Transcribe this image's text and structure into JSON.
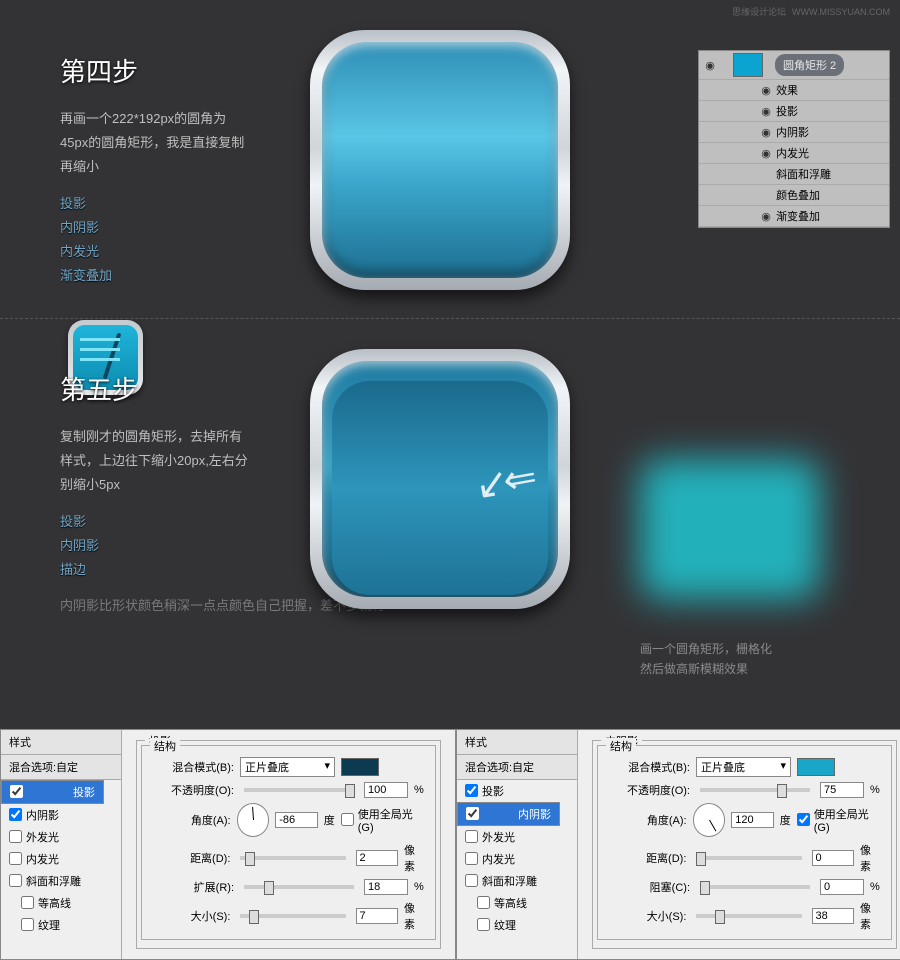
{
  "watermark": {
    "text": "思缘设计论坛",
    "url": "WWW.MISSYUAN.COM"
  },
  "step4": {
    "title": "第四步",
    "desc": "再画一个222*192px的圆角为45px的圆角矩形，我是直接复制再缩小",
    "effects": [
      "投影",
      "内阴影",
      "内发光",
      "渐变叠加"
    ]
  },
  "layers": {
    "name": "圆角矩形 2",
    "fxHeader": "效果",
    "items": [
      {
        "eye": true,
        "label": "投影"
      },
      {
        "eye": true,
        "label": "内阴影"
      },
      {
        "eye": true,
        "label": "内发光"
      },
      {
        "eye": false,
        "label": "斜面和浮雕"
      },
      {
        "eye": false,
        "label": "颜色叠加"
      },
      {
        "eye": true,
        "label": "渐变叠加"
      }
    ]
  },
  "step5": {
    "title": "第五步",
    "desc": "复制刚才的圆角矩形，去掉所有样式，上边往下缩小20px,左右分别缩小5px",
    "effects": [
      "投影",
      "内阴影",
      "描边"
    ],
    "note": "内阴影比形状颜色稍深一点点颜色自己把握，差不多就行",
    "caption1": "画一个圆角矩形，栅格化",
    "caption2": "然后做高斯模糊效果"
  },
  "dlg": {
    "stylesHdr": "样式",
    "blendOpt": "混合选项:自定",
    "items": [
      "投影",
      "内阴影",
      "外发光",
      "内发光",
      "斜面和浮雕",
      "等高线",
      "纹理"
    ],
    "struct": "结构",
    "blendMode": "混合模式(B):",
    "multiply": "正片叠底",
    "opacity": "不透明度(O):",
    "angle": "角度(A):",
    "deg": "度",
    "globalLight": "使用全局光(G)",
    "distance": "距离(D):",
    "spread": "扩展(R):",
    "size": "大小(S):",
    "choke": "阻塞(C):",
    "px": "像素",
    "pct": "%"
  },
  "d1": {
    "title": "投影",
    "selected": 0,
    "checked": [
      true,
      true,
      false,
      false,
      false,
      false,
      false
    ],
    "swatch": "#0c3a50",
    "opacity": "100",
    "angle": "-86",
    "globalLight": false,
    "distance": "2",
    "spread": "18",
    "size": "7",
    "sld": {
      "op": 92,
      "di": 4,
      "sp": 18,
      "sz": 8
    },
    "dial": 176
  },
  "d2": {
    "title": "内阴影",
    "selected": 1,
    "checked": [
      true,
      true,
      false,
      false,
      false,
      false,
      false
    ],
    "swatch": "#1aa6c9",
    "opacity": "75",
    "angle": "120",
    "globalLight": true,
    "distance": "0",
    "choke": "0",
    "size": "38",
    "sld": {
      "op": 70,
      "di": 0,
      "ch": 0,
      "sz": 18
    },
    "dial": -30
  }
}
